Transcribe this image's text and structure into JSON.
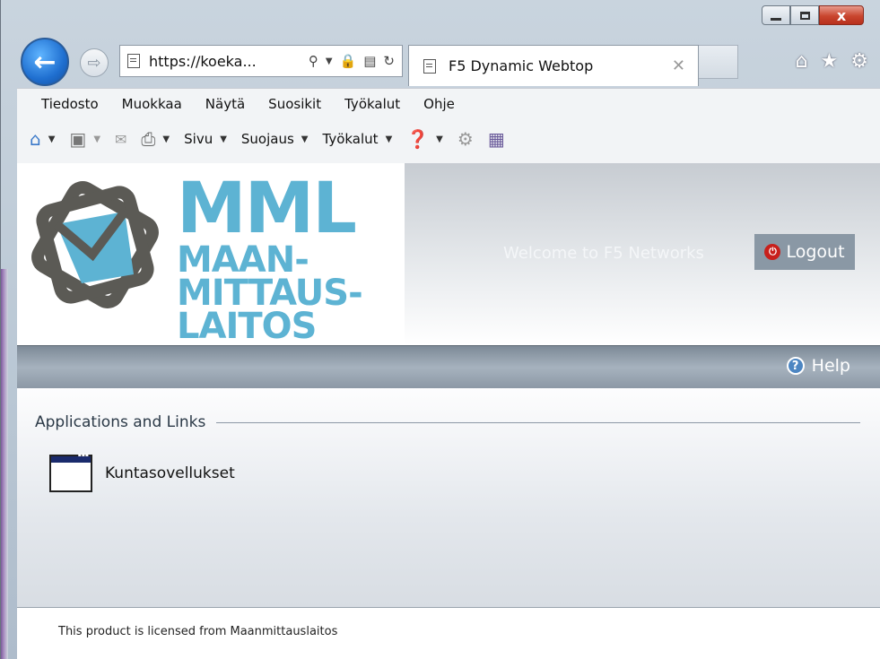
{
  "browser": {
    "address_text": "https://koeka...",
    "tab_title": "F5 Dynamic Webtop",
    "menu": [
      "Tiedosto",
      "Muokkaa",
      "Näytä",
      "Suosikit",
      "Työkalut",
      "Ohje"
    ],
    "command_bar": {
      "page_label": "Sivu",
      "security_label": "Suojaus",
      "tools_label": "Työkalut"
    },
    "caption": {
      "close": "x"
    }
  },
  "header": {
    "logo_line1": "MML",
    "logo_line2": "MAAN-",
    "logo_line3": "MITTAUS-",
    "logo_line4": "LAITOS",
    "welcome": "Welcome to F5 Networks",
    "logout_label": "Logout"
  },
  "toolbar": {
    "help_label": "Help"
  },
  "content": {
    "section_title": "Applications and Links",
    "apps": [
      {
        "label": "Kuntasovellukset"
      }
    ]
  },
  "footer": {
    "text": "This product is licensed from Maanmittauslaitos"
  },
  "colors": {
    "logo_blue": "#5db3d3",
    "logo_gray": "#5b5a55",
    "logout_bg": "#8a98a5"
  }
}
